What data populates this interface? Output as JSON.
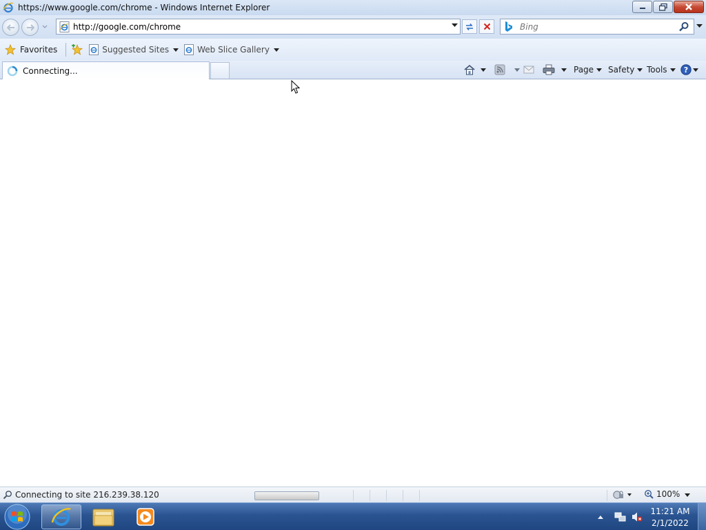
{
  "window": {
    "title": "https://www.google.com/chrome - Windows Internet Explorer",
    "controls": [
      "minimize",
      "maximize",
      "close"
    ]
  },
  "address_bar": {
    "url": "http://google.com/chrome",
    "page_icon": "ie-page-icon"
  },
  "search": {
    "placeholder": "Bing",
    "provider_icon": "bing-icon"
  },
  "favorites_bar": {
    "favorites_label": "Favorites",
    "links": [
      {
        "label": "Suggested Sites",
        "icon": "ie-page-icon"
      },
      {
        "label": "Web Slice Gallery",
        "icon": "ie-page-icon"
      }
    ]
  },
  "tabs": [
    {
      "label": "Connecting...",
      "state": "loading"
    }
  ],
  "command_bar": {
    "page_label": "Page",
    "safety_label": "Safety",
    "tools_label": "Tools"
  },
  "status_bar": {
    "text": "Connecting to site 216.239.38.120",
    "progress": 1.0,
    "zoom": "100%"
  },
  "taskbar": {
    "pinned": [
      "internet-explorer",
      "windows-explorer",
      "windows-media-player"
    ],
    "active": "internet-explorer"
  },
  "clock": {
    "time": "11:21 AM",
    "date": "2/1/2022"
  },
  "colors": {
    "chrome_blue": "#d2e0f3",
    "taskbar_blue": "#2a5491",
    "close_red": "#c64b34"
  }
}
